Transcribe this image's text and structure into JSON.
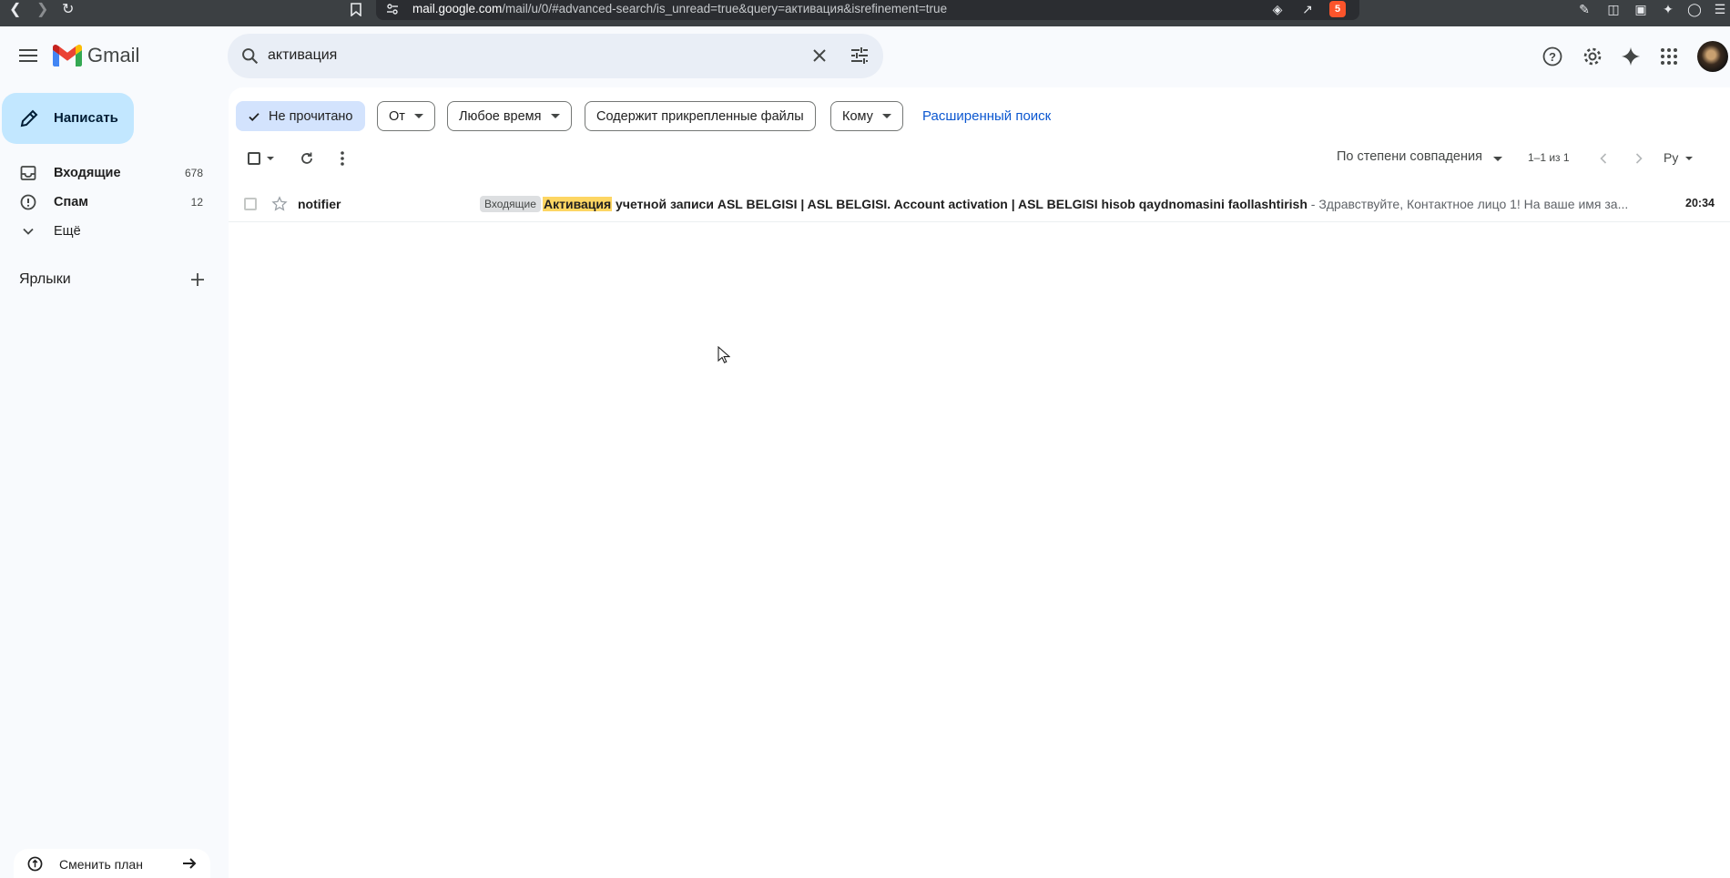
{
  "browser": {
    "url_host": "mail.google.com",
    "url_rest": "/mail/u/0/#advanced-search/is_unread=true&query=активация&isrefinement=true",
    "brave_badge": "5"
  },
  "app": {
    "name": "Gmail"
  },
  "search": {
    "value": "активация"
  },
  "sidebar": {
    "compose_label": "Написать",
    "items": [
      {
        "label": "Входящие",
        "count": "678"
      },
      {
        "label": "Спам",
        "count": "12"
      },
      {
        "label": "Ещё",
        "count": ""
      }
    ],
    "labels_header": "Ярлыки",
    "upgrade_label": "Сменить план"
  },
  "filters": {
    "unread": "Не прочитано",
    "from": "От",
    "time": "Любое время",
    "attachments": "Содержит прикрепленные файлы",
    "to": "Кому",
    "advanced": "Расширенный поиск"
  },
  "toolbar": {
    "sort": "По степени совпадения",
    "range": "1–1 из 1",
    "lang": "Ру"
  },
  "emails": [
    {
      "sender": "notifier",
      "badge": "Входящие",
      "highlight": "Активация",
      "subject": " учетной записи ASL BELGISI | ASL BELGISI. Account activation | ASL BELGISI hisob qaydnomasini faollashtirish",
      "snippet": " - Здравствуйте, Контактное лицо 1! На ваше имя за...",
      "time": "20:34"
    }
  ],
  "colors": {
    "accent": "#0b57d0",
    "compose_bg": "#c2e7ff",
    "highlight": "#fdd663"
  }
}
